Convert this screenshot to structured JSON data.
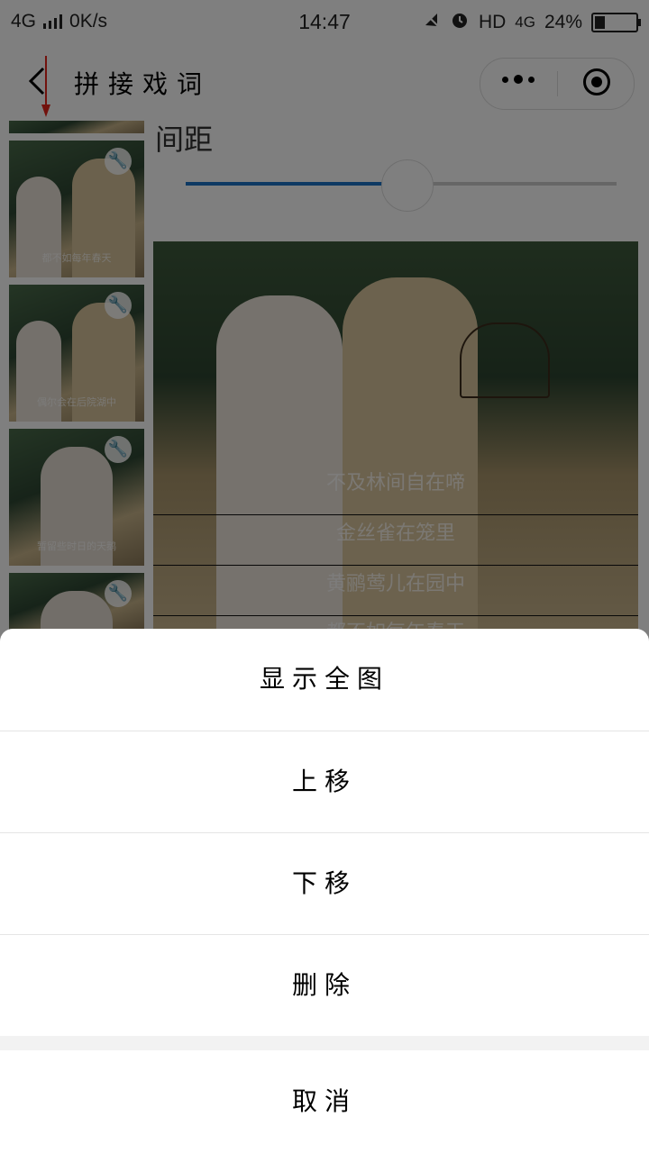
{
  "status_bar": {
    "network": "4G",
    "speed": "0K/s",
    "time": "14:47",
    "hd": "HD",
    "network_right": "4G",
    "battery_percent": "24%",
    "battery_level": 0.24
  },
  "header": {
    "title": "拼接戏词"
  },
  "content": {
    "spacing_label": "间距",
    "slider_value": 0.5,
    "thumbnails": [
      {
        "caption": ""
      },
      {
        "caption": "都不如每年春天"
      },
      {
        "caption": "偶尔会在后院湖中"
      },
      {
        "caption": "暂留些时日的天鹅"
      },
      {
        "caption": ""
      }
    ],
    "preview_lines": [
      "不及林间自在啼",
      "金丝雀在笼里",
      "黄鹂莺儿在园中",
      "都不如每年春天"
    ]
  },
  "action_sheet": {
    "items": [
      "显示全图",
      "上移",
      "下移",
      "删除"
    ],
    "cancel": "取消"
  },
  "colors": {
    "accent": "#1a73c6",
    "overlay": "rgba(0,0,0,0.5)",
    "arrow": "#e5251b"
  }
}
